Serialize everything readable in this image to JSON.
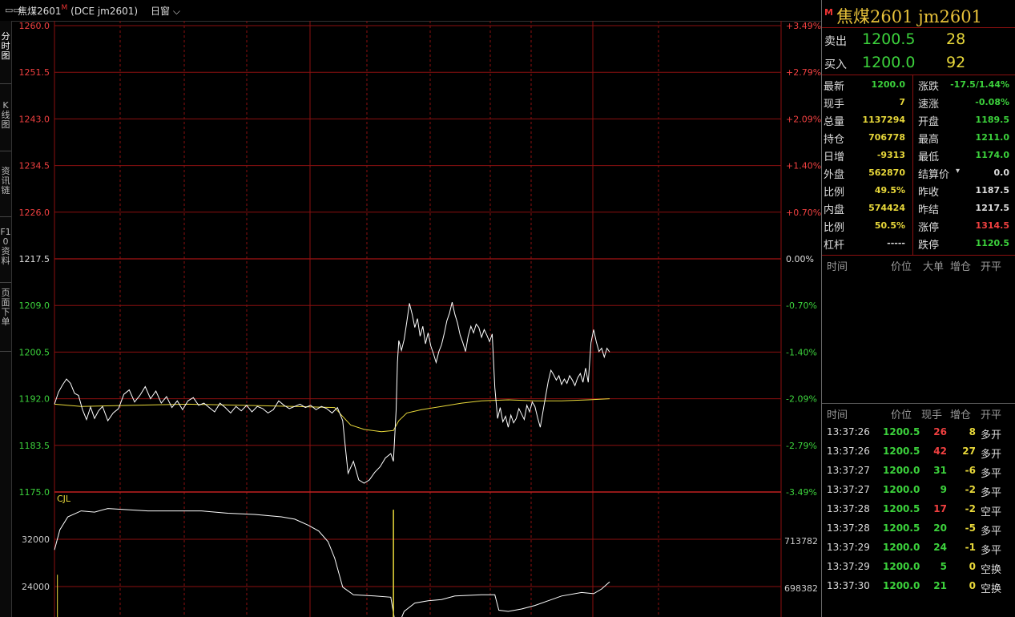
{
  "header": {
    "cursor_icon": "crosshair-icon",
    "title": "焦煤2601",
    "market_flag": "M",
    "code": "(DCE jm2601)",
    "period": "日窗"
  },
  "left_tabs": [
    {
      "label": "分时图",
      "active": true
    },
    {
      "label": "K线图",
      "active": false
    },
    {
      "label": "资讯链",
      "active": false
    },
    {
      "label": "F10资料",
      "active": false
    },
    {
      "label": "页面下单",
      "active": false
    }
  ],
  "chart_data": {
    "type": "line",
    "price_axis": {
      "labels": [
        "1260.0",
        "1251.5",
        "1243.0",
        "1234.5",
        "1226.0",
        "1217.5",
        "1209.0",
        "1200.5",
        "1192.0",
        "1183.5",
        "1175.0"
      ],
      "pct_labels": [
        "+3.49%",
        "+2.79%",
        "+2.09%",
        "+1.40%",
        "+0.70%",
        "0.00%",
        "-0.70%",
        "-1.40%",
        "-2.09%",
        "-2.79%",
        "-3.49%"
      ],
      "ylim": [
        1175.0,
        1260.0
      ],
      "prev_settle": 1217.5
    },
    "volume_axis": {
      "label": "CJL",
      "left_labels": [
        "32000",
        "24000"
      ],
      "right_labels": [
        "713782",
        "698382"
      ]
    },
    "price_series": [
      {
        "x": 0,
        "y": 1191.0
      },
      {
        "x": 3,
        "y": 1193.2
      },
      {
        "x": 6,
        "y": 1194.5
      },
      {
        "x": 9,
        "y": 1195.6
      },
      {
        "x": 12,
        "y": 1194.8
      },
      {
        "x": 15,
        "y": 1193.0
      },
      {
        "x": 18,
        "y": 1192.6
      },
      {
        "x": 21,
        "y": 1190.0
      },
      {
        "x": 24,
        "y": 1188.2
      },
      {
        "x": 27,
        "y": 1190.5
      },
      {
        "x": 30,
        "y": 1188.4
      },
      {
        "x": 33,
        "y": 1189.8
      },
      {
        "x": 36,
        "y": 1190.6
      },
      {
        "x": 40,
        "y": 1188.0
      },
      {
        "x": 44,
        "y": 1189.4
      },
      {
        "x": 48,
        "y": 1190.2
      },
      {
        "x": 52,
        "y": 1192.8
      },
      {
        "x": 56,
        "y": 1193.6
      },
      {
        "x": 60,
        "y": 1191.4
      },
      {
        "x": 64,
        "y": 1192.6
      },
      {
        "x": 68,
        "y": 1194.2
      },
      {
        "x": 72,
        "y": 1192.0
      },
      {
        "x": 76,
        "y": 1193.4
      },
      {
        "x": 80,
        "y": 1191.2
      },
      {
        "x": 84,
        "y": 1192.4
      },
      {
        "x": 88,
        "y": 1190.4
      },
      {
        "x": 92,
        "y": 1191.6
      },
      {
        "x": 96,
        "y": 1190.0
      },
      {
        "x": 100,
        "y": 1191.6
      },
      {
        "x": 104,
        "y": 1192.2
      },
      {
        "x": 108,
        "y": 1190.8
      },
      {
        "x": 112,
        "y": 1191.2
      },
      {
        "x": 116,
        "y": 1190.4
      },
      {
        "x": 120,
        "y": 1189.6
      },
      {
        "x": 124,
        "y": 1191.2
      },
      {
        "x": 128,
        "y": 1190.4
      },
      {
        "x": 132,
        "y": 1189.4
      },
      {
        "x": 136,
        "y": 1190.6
      },
      {
        "x": 140,
        "y": 1189.8
      },
      {
        "x": 144,
        "y": 1190.8
      },
      {
        "x": 148,
        "y": 1189.6
      },
      {
        "x": 152,
        "y": 1190.6
      },
      {
        "x": 156,
        "y": 1190.2
      },
      {
        "x": 160,
        "y": 1189.4
      },
      {
        "x": 164,
        "y": 1190.0
      },
      {
        "x": 168,
        "y": 1191.6
      },
      {
        "x": 172,
        "y": 1190.8
      },
      {
        "x": 176,
        "y": 1190.2
      },
      {
        "x": 180,
        "y": 1190.6
      },
      {
        "x": 184,
        "y": 1191.0
      },
      {
        "x": 188,
        "y": 1190.4
      },
      {
        "x": 192,
        "y": 1190.8
      },
      {
        "x": 196,
        "y": 1190.0
      },
      {
        "x": 200,
        "y": 1190.6
      },
      {
        "x": 204,
        "y": 1190.2
      },
      {
        "x": 208,
        "y": 1189.4
      },
      {
        "x": 212,
        "y": 1190.4
      },
      {
        "x": 216,
        "y": 1188.0
      },
      {
        "x": 218,
        "y": 1183.0
      },
      {
        "x": 220,
        "y": 1178.4
      },
      {
        "x": 224,
        "y": 1180.6
      },
      {
        "x": 228,
        "y": 1177.2
      },
      {
        "x": 232,
        "y": 1176.6
      },
      {
        "x": 236,
        "y": 1177.2
      },
      {
        "x": 240,
        "y": 1178.6
      },
      {
        "x": 244,
        "y": 1179.6
      },
      {
        "x": 248,
        "y": 1181.2
      },
      {
        "x": 252,
        "y": 1182.0
      },
      {
        "x": 254,
        "y": 1180.6
      },
      {
        "x": 256,
        "y": 1190.0
      },
      {
        "x": 257,
        "y": 1198.6
      },
      {
        "x": 258,
        "y": 1202.6
      },
      {
        "x": 260,
        "y": 1200.8
      },
      {
        "x": 262,
        "y": 1202.8
      },
      {
        "x": 264,
        "y": 1206.0
      },
      {
        "x": 266,
        "y": 1209.4
      },
      {
        "x": 268,
        "y": 1207.4
      },
      {
        "x": 270,
        "y": 1205.0
      },
      {
        "x": 272,
        "y": 1206.6
      },
      {
        "x": 274,
        "y": 1203.4
      },
      {
        "x": 276,
        "y": 1205.2
      },
      {
        "x": 278,
        "y": 1202.0
      },
      {
        "x": 280,
        "y": 1204.0
      },
      {
        "x": 282,
        "y": 1201.6
      },
      {
        "x": 284,
        "y": 1200.2
      },
      {
        "x": 286,
        "y": 1198.6
      },
      {
        "x": 288,
        "y": 1200.6
      },
      {
        "x": 290,
        "y": 1201.8
      },
      {
        "x": 292,
        "y": 1203.8
      },
      {
        "x": 294,
        "y": 1206.2
      },
      {
        "x": 296,
        "y": 1207.6
      },
      {
        "x": 298,
        "y": 1209.6
      },
      {
        "x": 300,
        "y": 1207.4
      },
      {
        "x": 302,
        "y": 1205.8
      },
      {
        "x": 304,
        "y": 1203.6
      },
      {
        "x": 306,
        "y": 1202.2
      },
      {
        "x": 308,
        "y": 1200.6
      },
      {
        "x": 310,
        "y": 1203.4
      },
      {
        "x": 312,
        "y": 1205.2
      },
      {
        "x": 314,
        "y": 1204.0
      },
      {
        "x": 316,
        "y": 1205.6
      },
      {
        "x": 318,
        "y": 1205.0
      },
      {
        "x": 320,
        "y": 1203.2
      },
      {
        "x": 322,
        "y": 1204.6
      },
      {
        "x": 324,
        "y": 1203.6
      },
      {
        "x": 326,
        "y": 1202.4
      },
      {
        "x": 328,
        "y": 1203.8
      },
      {
        "x": 330,
        "y": 1194.0
      },
      {
        "x": 332,
        "y": 1188.4
      },
      {
        "x": 334,
        "y": 1190.4
      },
      {
        "x": 336,
        "y": 1187.8
      },
      {
        "x": 338,
        "y": 1188.8
      },
      {
        "x": 340,
        "y": 1186.8
      },
      {
        "x": 342,
        "y": 1189.0
      },
      {
        "x": 344,
        "y": 1187.6
      },
      {
        "x": 346,
        "y": 1188.4
      },
      {
        "x": 348,
        "y": 1190.2
      },
      {
        "x": 350,
        "y": 1189.2
      },
      {
        "x": 352,
        "y": 1188.2
      },
      {
        "x": 354,
        "y": 1190.8
      },
      {
        "x": 356,
        "y": 1189.6
      },
      {
        "x": 358,
        "y": 1191.4
      },
      {
        "x": 360,
        "y": 1190.6
      },
      {
        "x": 362,
        "y": 1188.6
      },
      {
        "x": 364,
        "y": 1186.8
      },
      {
        "x": 366,
        "y": 1189.6
      },
      {
        "x": 368,
        "y": 1192.4
      },
      {
        "x": 370,
        "y": 1195.2
      },
      {
        "x": 372,
        "y": 1197.2
      },
      {
        "x": 374,
        "y": 1196.4
      },
      {
        "x": 376,
        "y": 1195.4
      },
      {
        "x": 378,
        "y": 1196.2
      },
      {
        "x": 380,
        "y": 1194.6
      },
      {
        "x": 382,
        "y": 1195.6
      },
      {
        "x": 384,
        "y": 1194.8
      },
      {
        "x": 386,
        "y": 1196.2
      },
      {
        "x": 388,
        "y": 1195.4
      },
      {
        "x": 390,
        "y": 1194.4
      },
      {
        "x": 392,
        "y": 1195.8
      },
      {
        "x": 394,
        "y": 1196.6
      },
      {
        "x": 396,
        "y": 1195.0
      },
      {
        "x": 398,
        "y": 1197.6
      },
      {
        "x": 400,
        "y": 1195.0
      },
      {
        "x": 402,
        "y": 1202.2
      },
      {
        "x": 404,
        "y": 1204.6
      },
      {
        "x": 406,
        "y": 1202.4
      },
      {
        "x": 408,
        "y": 1200.6
      },
      {
        "x": 410,
        "y": 1201.2
      },
      {
        "x": 412,
        "y": 1199.6
      },
      {
        "x": 414,
        "y": 1201.2
      },
      {
        "x": 416,
        "y": 1200.5
      }
    ],
    "avg_series": [
      {
        "x": 0,
        "y": 1191.0
      },
      {
        "x": 20,
        "y": 1190.6
      },
      {
        "x": 60,
        "y": 1190.8
      },
      {
        "x": 100,
        "y": 1191.0
      },
      {
        "x": 140,
        "y": 1190.8
      },
      {
        "x": 180,
        "y": 1190.6
      },
      {
        "x": 210,
        "y": 1190.4
      },
      {
        "x": 215,
        "y": 1189.0
      },
      {
        "x": 222,
        "y": 1187.2
      },
      {
        "x": 232,
        "y": 1186.4
      },
      {
        "x": 245,
        "y": 1186.0
      },
      {
        "x": 254,
        "y": 1186.2
      },
      {
        "x": 258,
        "y": 1188.0
      },
      {
        "x": 264,
        "y": 1189.4
      },
      {
        "x": 275,
        "y": 1190.0
      },
      {
        "x": 290,
        "y": 1190.6
      },
      {
        "x": 305,
        "y": 1191.2
      },
      {
        "x": 320,
        "y": 1191.6
      },
      {
        "x": 340,
        "y": 1191.8
      },
      {
        "x": 360,
        "y": 1191.6
      },
      {
        "x": 380,
        "y": 1191.6
      },
      {
        "x": 400,
        "y": 1191.8
      },
      {
        "x": 416,
        "y": 1192.0
      }
    ],
    "volume_series": [
      {
        "x": 0,
        "y": 30200
      },
      {
        "x": 4,
        "y": 33600
      },
      {
        "x": 10,
        "y": 35800
      },
      {
        "x": 20,
        "y": 36800
      },
      {
        "x": 30,
        "y": 36600
      },
      {
        "x": 40,
        "y": 37200
      },
      {
        "x": 55,
        "y": 37000
      },
      {
        "x": 70,
        "y": 36800
      },
      {
        "x": 90,
        "y": 36800
      },
      {
        "x": 110,
        "y": 36800
      },
      {
        "x": 130,
        "y": 36400
      },
      {
        "x": 150,
        "y": 36200
      },
      {
        "x": 170,
        "y": 35800
      },
      {
        "x": 180,
        "y": 35400
      },
      {
        "x": 190,
        "y": 34400
      },
      {
        "x": 198,
        "y": 33400
      },
      {
        "x": 205,
        "y": 31600
      },
      {
        "x": 210,
        "y": 28800
      },
      {
        "x": 216,
        "y": 23900
      },
      {
        "x": 224,
        "y": 22600
      },
      {
        "x": 240,
        "y": 22400
      },
      {
        "x": 252,
        "y": 22200
      },
      {
        "x": 254,
        "y": 19600
      },
      {
        "x": 256,
        "y": 16800
      },
      {
        "x": 258,
        "y": 17600
      },
      {
        "x": 262,
        "y": 19800
      },
      {
        "x": 270,
        "y": 21200
      },
      {
        "x": 280,
        "y": 21600
      },
      {
        "x": 290,
        "y": 21800
      },
      {
        "x": 300,
        "y": 22400
      },
      {
        "x": 320,
        "y": 22600
      },
      {
        "x": 330,
        "y": 22600
      },
      {
        "x": 333,
        "y": 20000
      },
      {
        "x": 340,
        "y": 19800
      },
      {
        "x": 350,
        "y": 20200
      },
      {
        "x": 360,
        "y": 20800
      },
      {
        "x": 370,
        "y": 21600
      },
      {
        "x": 380,
        "y": 22400
      },
      {
        "x": 395,
        "y": 23000
      },
      {
        "x": 404,
        "y": 22800
      },
      {
        "x": 410,
        "y": 23600
      },
      {
        "x": 416,
        "y": 24800
      }
    ],
    "spike_volume": {
      "x": 254,
      "y": 37000
    },
    "initial_bar": {
      "x": 1,
      "y": 26000
    }
  },
  "quote": {
    "market_flag": "M",
    "title": "焦煤2601  jm2601",
    "ask_label": "卖出",
    "ask_price": "1200.5",
    "ask_vol": "28",
    "bid_label": "买入",
    "bid_price": "1200.0",
    "bid_vol": "92",
    "stats": [
      {
        "l1": "最新",
        "v1": "1200.0",
        "c1": "green",
        "l2": "涨跌",
        "v2": "-17.5/1.44%",
        "c2": "green"
      },
      {
        "l1": "现手",
        "v1": "7",
        "c1": "yellow",
        "l2": "速涨",
        "v2": "-0.08%",
        "c2": "green"
      },
      {
        "l1": "总量",
        "v1": "1137294",
        "c1": "yellow",
        "l2": "开盘",
        "v2": "1189.5",
        "c2": "green"
      },
      {
        "l1": "持仓",
        "v1": "706778",
        "c1": "yellow",
        "l2": "最高",
        "v2": "1211.0",
        "c2": "green"
      },
      {
        "l1": "日增",
        "v1": "-9313",
        "c1": "yellow",
        "l2": "最低",
        "v2": "1174.0",
        "c2": "green"
      },
      {
        "l1": "外盘",
        "v1": "562870",
        "c1": "yellow",
        "l2": "结算价",
        "v2": "0.0",
        "c2": "white"
      },
      {
        "l1": "比例",
        "v1": "49.5%",
        "c1": "yellow",
        "l2": "昨收",
        "v2": "1187.5",
        "c2": "white"
      },
      {
        "l1": "内盘",
        "v1": "574424",
        "c1": "yellow",
        "l2": "昨结",
        "v2": "1217.5",
        "c2": "white"
      },
      {
        "l1": "比例",
        "v1": "50.5%",
        "c1": "yellow",
        "l2": "涨停",
        "v2": "1314.5",
        "c2": "red"
      },
      {
        "l1": "杠杆",
        "v1": "-----",
        "c1": "white",
        "l2": "跌停",
        "v2": "1120.5",
        "c2": "green"
      }
    ],
    "settle_dropdown_icon": "caret-down-icon",
    "bigorder_header": [
      "时间",
      "价位",
      "大单",
      "增仓",
      "开平"
    ],
    "ticks_header": [
      "时间",
      "价位",
      "现手",
      "增仓",
      "开平"
    ],
    "ticks": [
      {
        "time": "13:37:26",
        "price": "1200.5",
        "vol": "26",
        "vc": "red",
        "inc": "8",
        "ic": "yellow",
        "type": "多开"
      },
      {
        "time": "13:37:26",
        "price": "1200.5",
        "vol": "42",
        "vc": "red",
        "inc": "27",
        "ic": "yellow",
        "type": "多开"
      },
      {
        "time": "13:37:27",
        "price": "1200.0",
        "vol": "31",
        "vc": "green",
        "inc": "-6",
        "ic": "yellow",
        "type": "多平"
      },
      {
        "time": "13:37:27",
        "price": "1200.0",
        "vol": "9",
        "vc": "green",
        "inc": "-2",
        "ic": "yellow",
        "type": "多平"
      },
      {
        "time": "13:37:28",
        "price": "1200.5",
        "vol": "17",
        "vc": "red",
        "inc": "-2",
        "ic": "yellow",
        "type": "空平"
      },
      {
        "time": "13:37:28",
        "price": "1200.5",
        "vol": "20",
        "vc": "green",
        "inc": "-5",
        "ic": "yellow",
        "type": "多平"
      },
      {
        "time": "13:37:29",
        "price": "1200.0",
        "vol": "24",
        "vc": "green",
        "inc": "-1",
        "ic": "yellow",
        "type": "多平"
      },
      {
        "time": "13:37:29",
        "price": "1200.0",
        "vol": "5",
        "vc": "green",
        "inc": "0",
        "ic": "yellow",
        "type": "空换"
      },
      {
        "time": "13:37:30",
        "price": "1200.0",
        "vol": "21",
        "vc": "green",
        "inc": "0",
        "ic": "yellow",
        "type": "空换"
      }
    ]
  }
}
